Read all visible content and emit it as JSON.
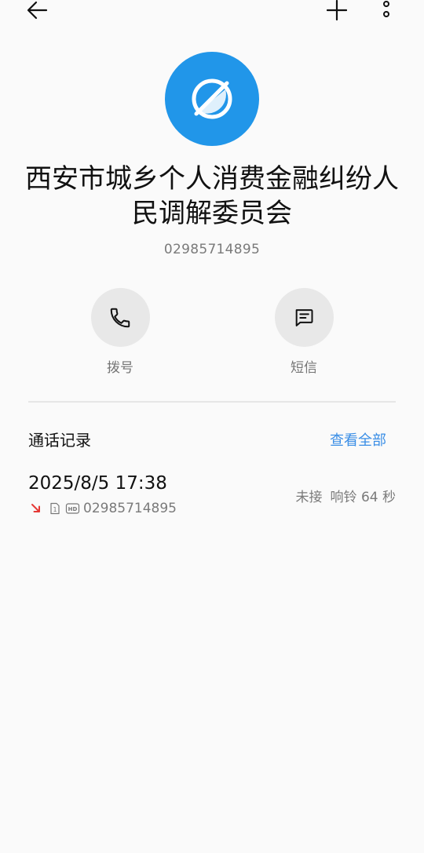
{
  "contact": {
    "name": "西安市城乡个人消费金融纠纷人民调解委员会",
    "number": "02985714895"
  },
  "actions": {
    "call_label": "拨号",
    "sms_label": "短信"
  },
  "call_log": {
    "title": "通话记录",
    "view_all": "查看全部",
    "entries": [
      {
        "date": "2025/8/5 17:38",
        "number": "02985714895",
        "status": "未接",
        "ring": "响铃 64 秒",
        "sim": "1",
        "badge": "HD"
      }
    ]
  },
  "icons": {
    "back": "arrow-left-icon",
    "add": "plus-icon",
    "more": "more-vertical-icon",
    "avatar": "contact-placeholder-icon",
    "call": "phone-icon",
    "sms": "message-icon",
    "missed": "missed-call-arrow-icon"
  },
  "colors": {
    "avatar": "#2196e9",
    "accent": "#3a8ee6",
    "missed": "#e53935"
  }
}
